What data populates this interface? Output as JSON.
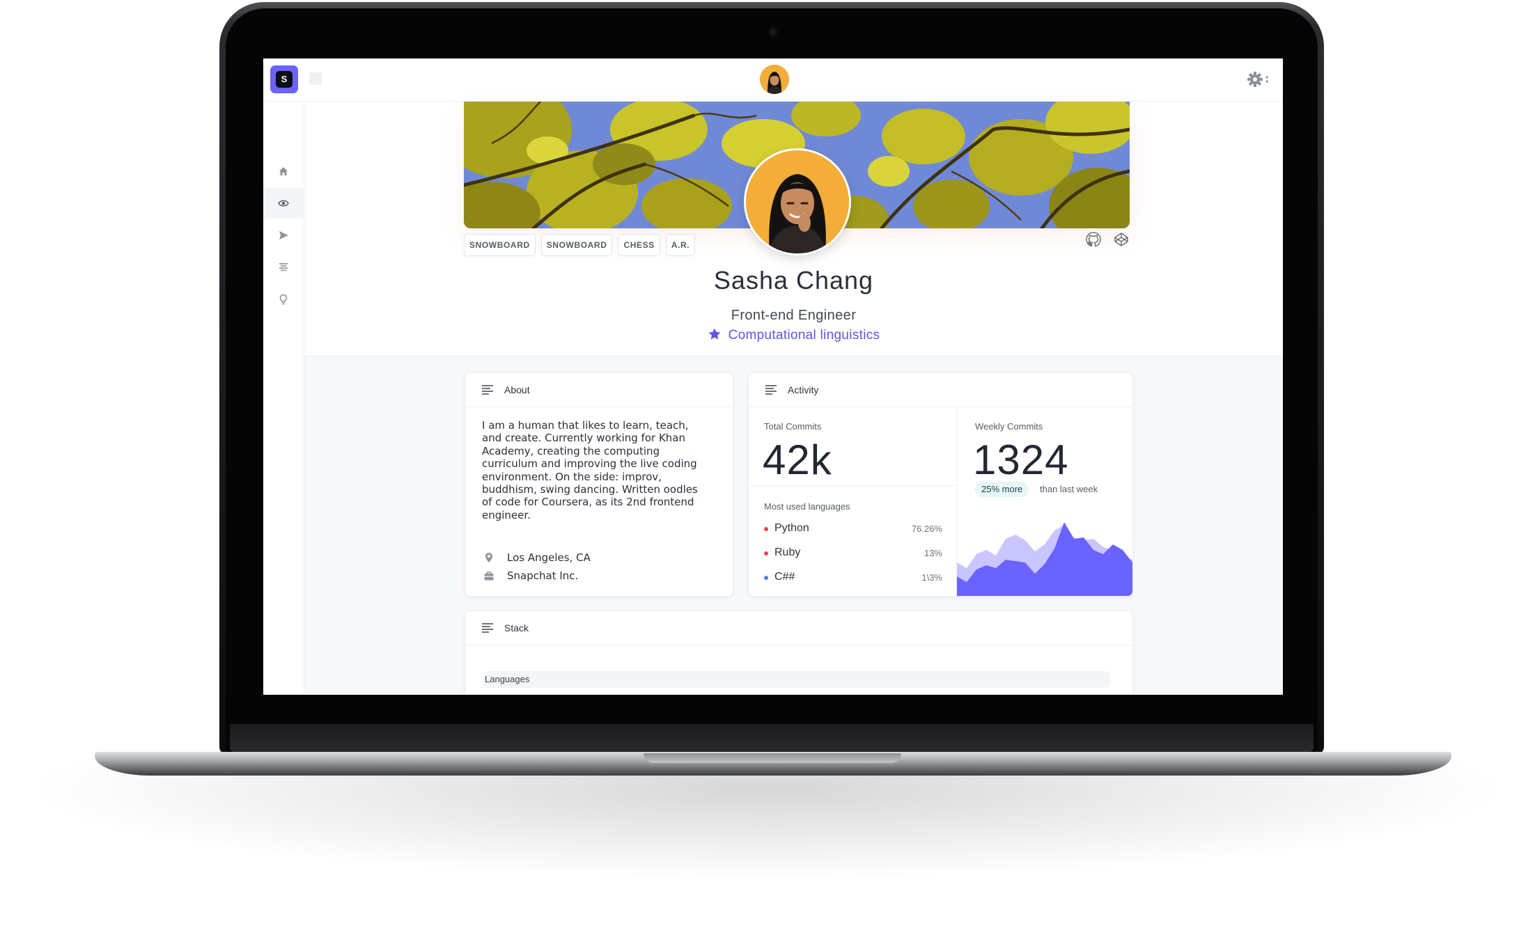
{
  "app": {
    "logo_letter": "S"
  },
  "sidebar": {
    "items": [
      {
        "icon": "home-icon"
      },
      {
        "icon": "eye-icon"
      },
      {
        "icon": "send-icon"
      },
      {
        "icon": "list-icon"
      },
      {
        "icon": "bulb-icon"
      }
    ]
  },
  "profile": {
    "name": "Sasha Chang",
    "role": "Front-end Engineer",
    "interest": "Computational linguistics",
    "tags": [
      "SNOWBOARD",
      "SNOWBOARD",
      "CHESS",
      "A.R."
    ]
  },
  "about": {
    "title": "About",
    "lines": [
      "I am a human that likes to learn, teach,",
      "and create. Currently working for Khan",
      "Academy, creating the computing",
      "curriculum and improving the live coding",
      "environment. On the side: improv,",
      "buddhism, swing dancing. Written oodles",
      "of code for Coursera, as its 2nd frontend",
      "engineer."
    ],
    "location": "Los Angeles, CA",
    "company": "Snapchat Inc."
  },
  "activity": {
    "title": "Activity",
    "total_label": "Total Commits",
    "total_value": "42k",
    "weekly_label": "Weekly Commits",
    "weekly_value": "1324",
    "badge": "25% more",
    "badge_suffix": "than last week",
    "languages_label": "Most used languages",
    "languages": [
      {
        "name": "Python",
        "pct": "76.26%",
        "color": "#e5484d"
      },
      {
        "name": "Ruby",
        "pct": "13%",
        "color": "#e5484d"
      },
      {
        "name": "C##",
        "pct": "1\\3%",
        "color": "#4d7cf2"
      }
    ],
    "colors": {
      "area": "#6a63ff",
      "area_faded": "#c9c6ff"
    }
  },
  "stack": {
    "title": "Stack",
    "sub_label": "Languages"
  },
  "colors": {
    "accent": "#6c63ff",
    "link": "#5f55e6"
  }
}
